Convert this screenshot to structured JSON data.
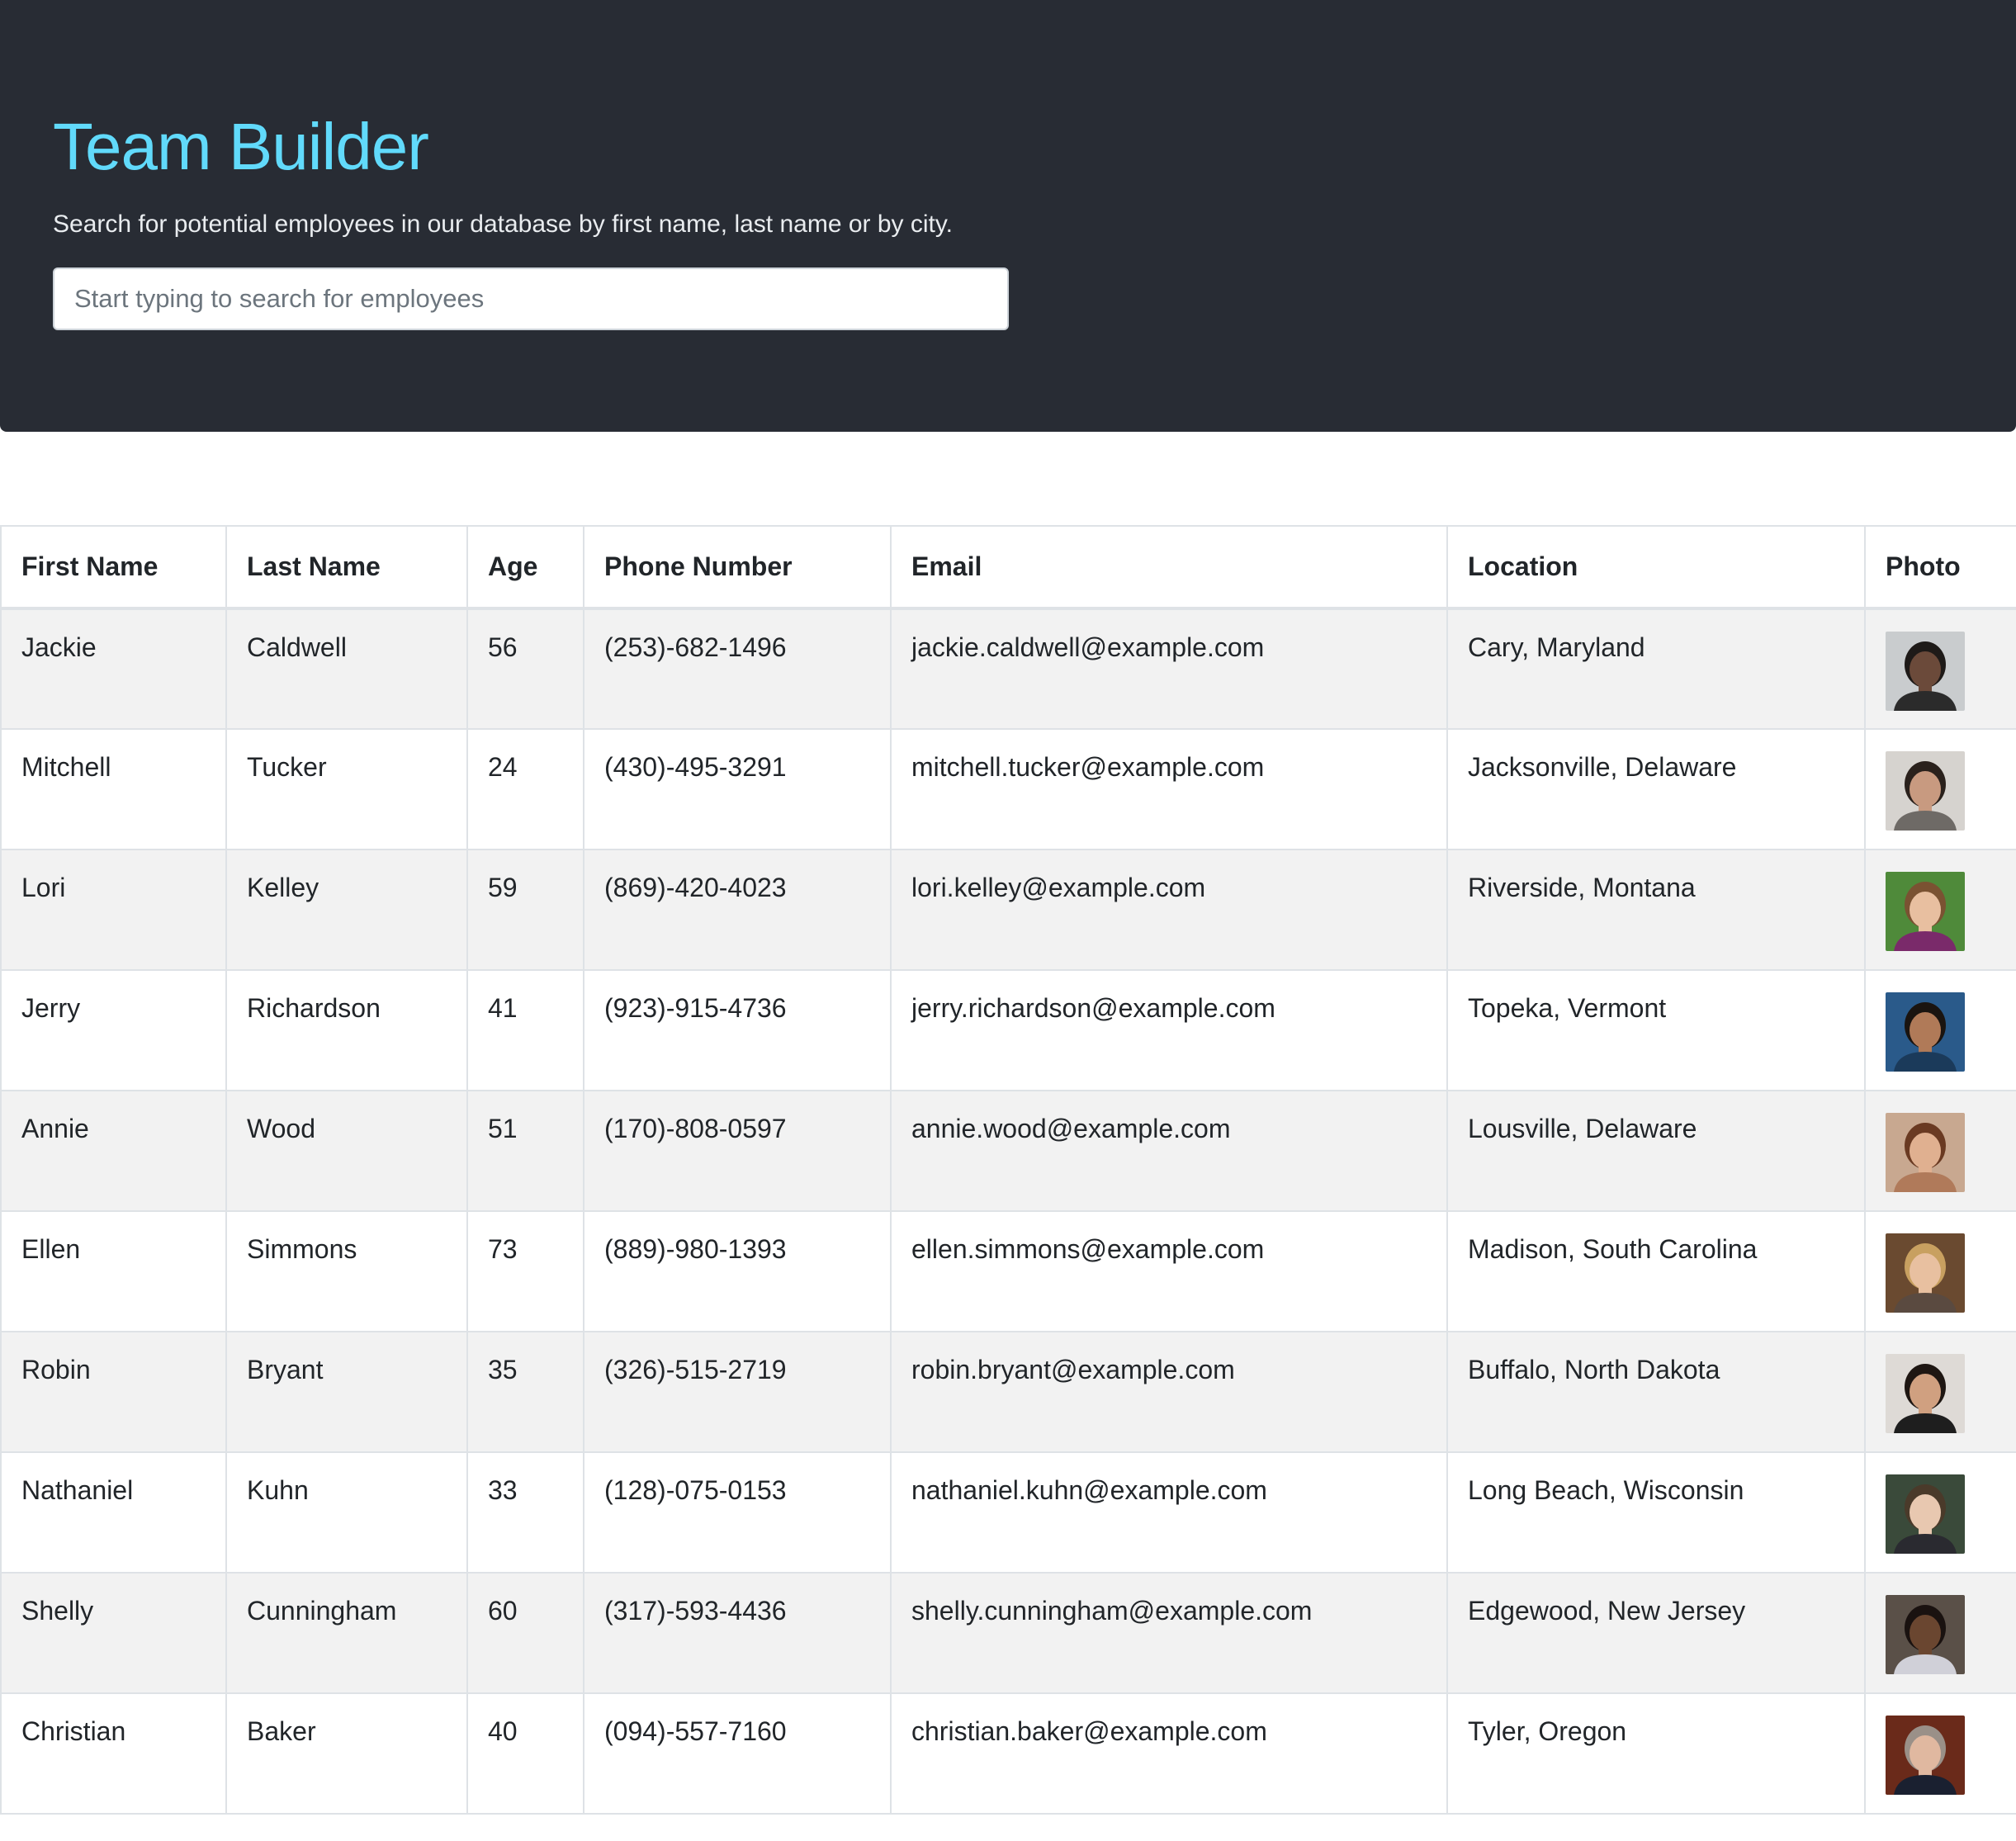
{
  "header": {
    "title": "Team Builder",
    "subtitle": "Search for potential employees in our database by first name, last name or by city.",
    "search_placeholder": "Start typing to search for employees",
    "search_value": ""
  },
  "colors": {
    "header_bg": "#282c34",
    "title": "#61dafb",
    "stripe": "#f2f2f2"
  },
  "table": {
    "columns": [
      "First Name",
      "Last Name",
      "Age",
      "Phone Number",
      "Email",
      "Location",
      "Photo"
    ],
    "rows": [
      {
        "first": "Jackie",
        "last": "Caldwell",
        "age": "56",
        "phone": "(253)-682-1496",
        "email": "jackie.caldwell@example.com",
        "location": "Cary, Maryland",
        "photo": "avatar-photo"
      },
      {
        "first": "Mitchell",
        "last": "Tucker",
        "age": "24",
        "phone": "(430)-495-3291",
        "email": "mitchell.tucker@example.com",
        "location": "Jacksonville, Delaware",
        "photo": "avatar-photo"
      },
      {
        "first": "Lori",
        "last": "Kelley",
        "age": "59",
        "phone": "(869)-420-4023",
        "email": "lori.kelley@example.com",
        "location": "Riverside, Montana",
        "photo": "avatar-photo"
      },
      {
        "first": "Jerry",
        "last": "Richardson",
        "age": "41",
        "phone": "(923)-915-4736",
        "email": "jerry.richardson@example.com",
        "location": "Topeka, Vermont",
        "photo": "avatar-photo"
      },
      {
        "first": "Annie",
        "last": "Wood",
        "age": "51",
        "phone": "(170)-808-0597",
        "email": "annie.wood@example.com",
        "location": "Lousville, Delaware",
        "photo": "avatar-photo"
      },
      {
        "first": "Ellen",
        "last": "Simmons",
        "age": "73",
        "phone": "(889)-980-1393",
        "email": "ellen.simmons@example.com",
        "location": "Madison, South Carolina",
        "photo": "avatar-photo"
      },
      {
        "first": "Robin",
        "last": "Bryant",
        "age": "35",
        "phone": "(326)-515-2719",
        "email": "robin.bryant@example.com",
        "location": "Buffalo, North Dakota",
        "photo": "avatar-photo"
      },
      {
        "first": "Nathaniel",
        "last": "Kuhn",
        "age": "33",
        "phone": "(128)-075-0153",
        "email": "nathaniel.kuhn@example.com",
        "location": "Long Beach, Wisconsin",
        "photo": "avatar-photo"
      },
      {
        "first": "Shelly",
        "last": "Cunningham",
        "age": "60",
        "phone": "(317)-593-4436",
        "email": "shelly.cunningham@example.com",
        "location": "Edgewood, New Jersey",
        "photo": "avatar-photo"
      },
      {
        "first": "Christian",
        "last": "Baker",
        "age": "40",
        "phone": "(094)-557-7160",
        "email": "christian.baker@example.com",
        "location": "Tyler, Oregon",
        "photo": "avatar-photo"
      }
    ]
  }
}
